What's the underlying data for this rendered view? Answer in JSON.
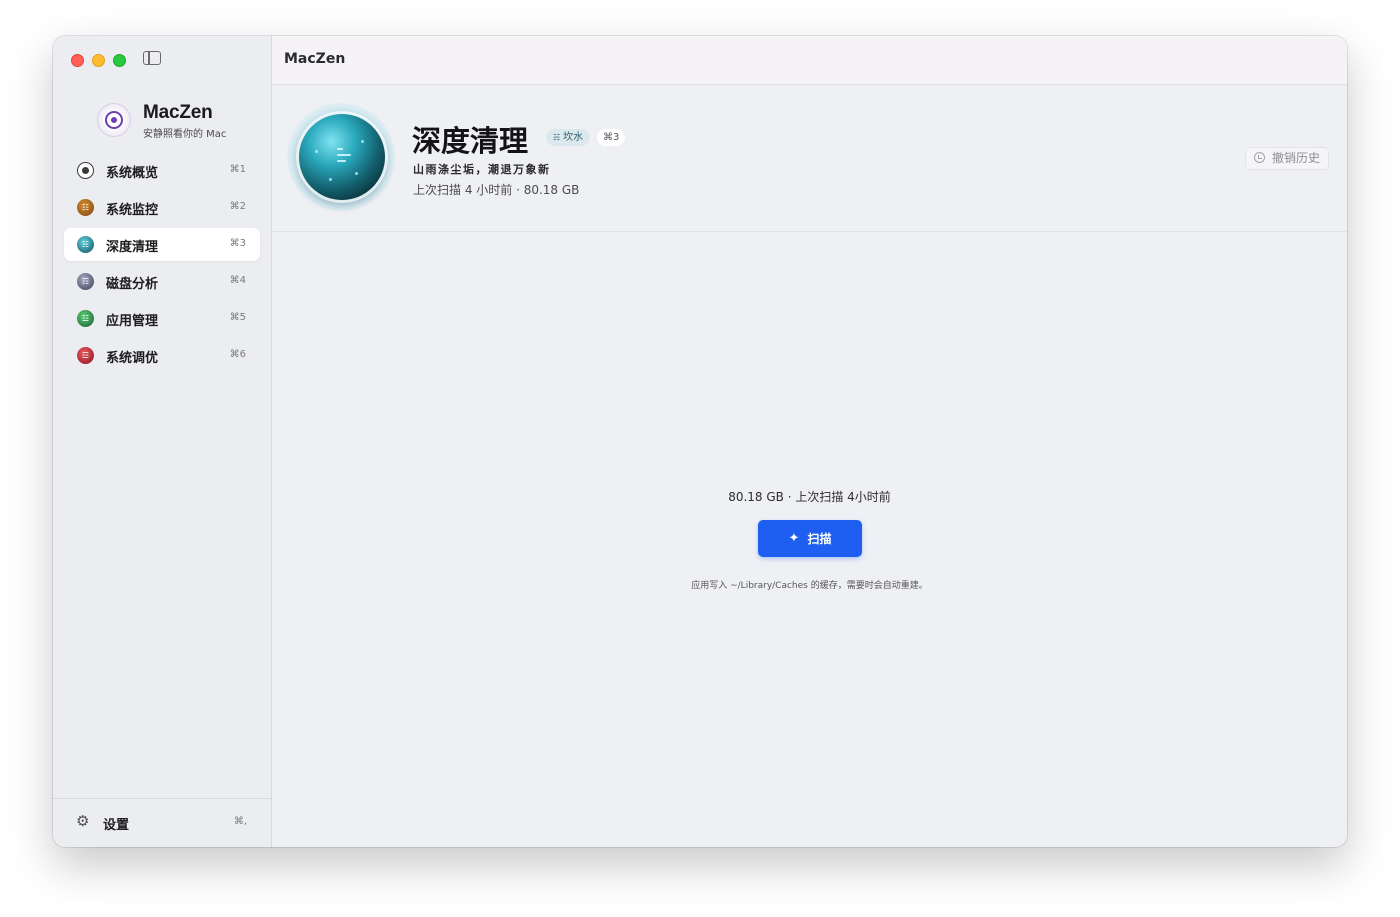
{
  "app": {
    "window_title": "MacZen",
    "brand_name": "MacZen",
    "brand_tagline": "安静照看你的 Mac"
  },
  "sidebar": {
    "items": [
      {
        "label": "系统概览",
        "shortcut": "⌘1",
        "icon": "overview-icon",
        "color": "#3a3a3a",
        "active": false
      },
      {
        "label": "系统监控",
        "shortcut": "⌘2",
        "icon": "monitor-icon",
        "color": "#8a5a1c",
        "active": false
      },
      {
        "label": "深度清理",
        "shortcut": "⌘3",
        "icon": "clean-icon",
        "color": "#1c6e7e",
        "active": true
      },
      {
        "label": "磁盘分析",
        "shortcut": "⌘4",
        "icon": "disk-icon",
        "color": "#4a4f6a",
        "active": false
      },
      {
        "label": "应用管理",
        "shortcut": "⌘5",
        "icon": "apps-icon",
        "color": "#1f7a3a",
        "active": false
      },
      {
        "label": "系统调优",
        "shortcut": "⌘6",
        "icon": "tune-icon",
        "color": "#b0202a",
        "active": false
      }
    ],
    "settings_label": "设置",
    "settings_shortcut": "⌘,"
  },
  "header": {
    "title": "深度清理",
    "badge_element": "坎水",
    "badge_shortcut": "⌘3",
    "motto": "山雨涤尘垢，潮退万象新",
    "scan_meta": "上次扫描 4 小时前 · 80.18 GB",
    "undo_label": "撤销历史"
  },
  "content": {
    "summary": "80.18 GB · 上次扫描 4小时前",
    "scan_button_label": "扫描",
    "cache_note": "应用写入 ~/Library/Caches 的缓存，需要时会自动重建。"
  },
  "colors": {
    "accent": "#1e5ff2",
    "sidebar_bg": "#ecedf0",
    "main_bg": "#eff0f4",
    "orb": "#13606e"
  }
}
